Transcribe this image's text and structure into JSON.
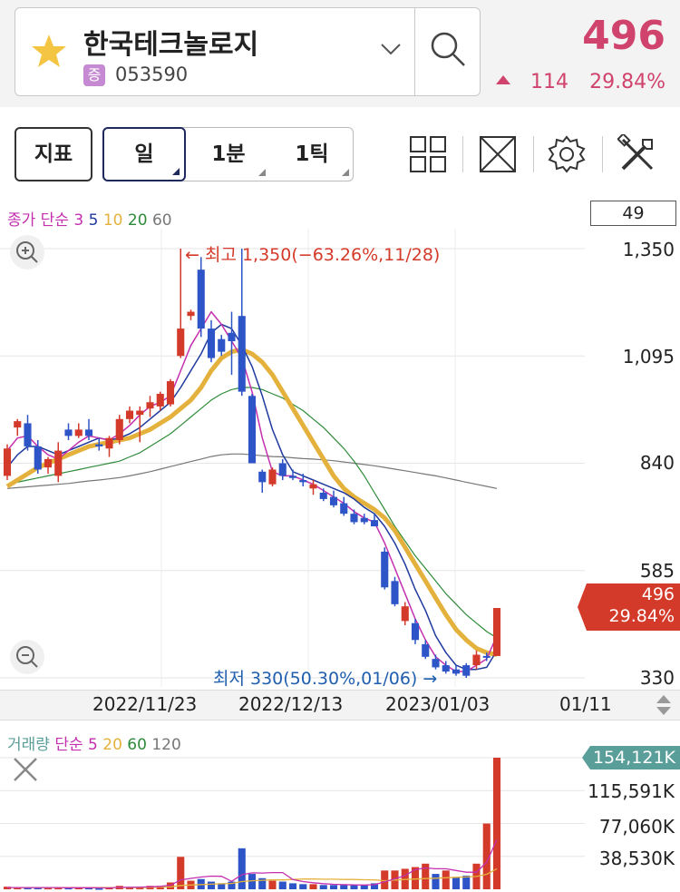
{
  "stock": {
    "name": "한국테크놀로지",
    "market_badge": "증",
    "code": "053590",
    "price": "496",
    "change_abs": "114",
    "change_pct": "29.84%",
    "direction": "up",
    "color_up": "#d0436c"
  },
  "toolbar": {
    "indicator_label": "지표",
    "period_tabs": [
      {
        "label": "일",
        "active": true
      },
      {
        "label": "1분",
        "active": false
      },
      {
        "label": "1틱",
        "active": false
      }
    ],
    "icons": [
      "layout-grid-icon",
      "fullscreen-icon",
      "settings-icon",
      "tools-icon"
    ]
  },
  "price_chart": {
    "legend_prefix": "종가 단순",
    "ma_periods": [
      "3",
      "5",
      "10",
      "20",
      "60"
    ],
    "ma_colors": [
      "#c42fae",
      "#1f3a9e",
      "#e4b23c",
      "#2e8b3a",
      "#777777"
    ],
    "visible_count": "49",
    "y_ticks": [
      "1,350",
      "1,095",
      "840",
      "585",
      "330"
    ],
    "current_tag": [
      "496",
      "29.84%"
    ],
    "high_annotation": "최고 1,350(−63.26%,11/28)",
    "low_annotation": "최저 330(50.30%,01/06)",
    "x_ticks": [
      "2022/11/23",
      "2022/12/13",
      "2023/01/03",
      "01/11"
    ]
  },
  "volume_chart": {
    "legend_prefix": "거래량 단순",
    "ma_periods": [
      "5",
      "20",
      "60",
      "120"
    ],
    "current_tag": "154,121K",
    "y_ticks": [
      "115,591K",
      "77,060K",
      "38,530K"
    ]
  },
  "chart_data": {
    "type": "candlestick",
    "ylim": [
      300,
      1400
    ],
    "candles": [
      {
        "o": 810,
        "h": 885,
        "l": 800,
        "c": 875,
        "up": true
      },
      {
        "o": 925,
        "h": 945,
        "l": 905,
        "c": 940,
        "up": true
      },
      {
        "o": 935,
        "h": 955,
        "l": 870,
        "c": 880,
        "up": false
      },
      {
        "o": 880,
        "h": 895,
        "l": 815,
        "c": 825,
        "up": false
      },
      {
        "o": 830,
        "h": 855,
        "l": 815,
        "c": 850,
        "up": true
      },
      {
        "o": 810,
        "h": 890,
        "l": 795,
        "c": 870,
        "up": true
      },
      {
        "o": 920,
        "h": 935,
        "l": 895,
        "c": 905,
        "up": false
      },
      {
        "o": 905,
        "h": 935,
        "l": 900,
        "c": 920,
        "up": true
      },
      {
        "o": 920,
        "h": 945,
        "l": 895,
        "c": 905,
        "up": false
      },
      {
        "o": 885,
        "h": 900,
        "l": 870,
        "c": 880,
        "up": false
      },
      {
        "o": 875,
        "h": 905,
        "l": 855,
        "c": 900,
        "up": true
      },
      {
        "o": 895,
        "h": 955,
        "l": 885,
        "c": 945,
        "up": true
      },
      {
        "o": 945,
        "h": 975,
        "l": 935,
        "c": 965,
        "up": true
      },
      {
        "o": 955,
        "h": 975,
        "l": 890,
        "c": 965,
        "up": true
      },
      {
        "o": 970,
        "h": 1000,
        "l": 950,
        "c": 985,
        "up": true
      },
      {
        "o": 975,
        "h": 1010,
        "l": 965,
        "c": 1005,
        "up": true
      },
      {
        "o": 980,
        "h": 1040,
        "l": 975,
        "c": 1035,
        "up": true
      },
      {
        "o": 1095,
        "h": 1350,
        "l": 1090,
        "c": 1160,
        "up": true
      },
      {
        "o": 1200,
        "h": 1205,
        "l": 1180,
        "c": 1190,
        "up": true
      },
      {
        "o": 1300,
        "h": 1330,
        "l": 1140,
        "c": 1160,
        "up": false
      },
      {
        "o": 1160,
        "h": 1180,
        "l": 1080,
        "c": 1090,
        "up": false
      },
      {
        "o": 1135,
        "h": 1145,
        "l": 1095,
        "c": 1105,
        "up": false
      },
      {
        "o": 1150,
        "h": 1200,
        "l": 1050,
        "c": 1130,
        "up": false
      },
      {
        "o": 1190,
        "h": 1350,
        "l": 1000,
        "c": 1010,
        "up": false
      },
      {
        "o": 1000,
        "h": 1005,
        "l": 840,
        "c": 840,
        "up": false
      },
      {
        "o": 820,
        "h": 825,
        "l": 770,
        "c": 795,
        "up": false
      },
      {
        "o": 790,
        "h": 830,
        "l": 785,
        "c": 825,
        "up": true
      },
      {
        "o": 840,
        "h": 850,
        "l": 800,
        "c": 810,
        "up": false
      },
      {
        "o": 810,
        "h": 825,
        "l": 800,
        "c": 805,
        "up": false
      },
      {
        "o": 800,
        "h": 815,
        "l": 785,
        "c": 795,
        "up": false
      },
      {
        "o": 780,
        "h": 800,
        "l": 765,
        "c": 790,
        "up": true
      },
      {
        "o": 770,
        "h": 780,
        "l": 750,
        "c": 755,
        "up": false
      },
      {
        "o": 760,
        "h": 775,
        "l": 735,
        "c": 740,
        "up": false
      },
      {
        "o": 745,
        "h": 760,
        "l": 715,
        "c": 720,
        "up": false
      },
      {
        "o": 720,
        "h": 730,
        "l": 695,
        "c": 700,
        "up": false
      },
      {
        "o": 710,
        "h": 720,
        "l": 695,
        "c": 700,
        "up": false
      },
      {
        "o": 705,
        "h": 720,
        "l": 690,
        "c": 690,
        "up": false
      },
      {
        "o": 630,
        "h": 640,
        "l": 540,
        "c": 545,
        "up": false
      },
      {
        "o": 560,
        "h": 570,
        "l": 500,
        "c": 505,
        "up": false
      },
      {
        "o": 500,
        "h": 510,
        "l": 455,
        "c": 465,
        "up": true
      },
      {
        "o": 460,
        "h": 470,
        "l": 410,
        "c": 420,
        "up": false
      },
      {
        "o": 410,
        "h": 420,
        "l": 375,
        "c": 380,
        "up": false
      },
      {
        "o": 375,
        "h": 385,
        "l": 350,
        "c": 355,
        "up": false
      },
      {
        "o": 360,
        "h": 370,
        "l": 340,
        "c": 345,
        "up": false
      },
      {
        "o": 350,
        "h": 360,
        "l": 335,
        "c": 340,
        "up": false
      },
      {
        "o": 335,
        "h": 365,
        "l": 330,
        "c": 360,
        "up": false
      },
      {
        "o": 360,
        "h": 395,
        "l": 350,
        "c": 385,
        "up": true
      },
      {
        "o": 380,
        "h": 390,
        "l": 370,
        "c": 382,
        "up": false
      },
      {
        "o": 382,
        "h": 496,
        "l": 382,
        "c": 496,
        "up": true
      }
    ],
    "ma3": [
      870,
      900,
      905,
      880,
      860,
      850,
      870,
      890,
      905,
      900,
      895,
      910,
      930,
      955,
      975,
      985,
      1000,
      1060,
      1120,
      1160,
      1200,
      1170,
      1130,
      1090,
      1010,
      900,
      820,
      810,
      810,
      800,
      790,
      775,
      760,
      745,
      725,
      710,
      700,
      650,
      590,
      530,
      470,
      420,
      380,
      360,
      345,
      345,
      360,
      375,
      430
    ],
    "ma5": [
      830,
      860,
      880,
      880,
      870,
      860,
      870,
      880,
      890,
      900,
      895,
      900,
      910,
      925,
      945,
      965,
      985,
      1020,
      1060,
      1100,
      1150,
      1170,
      1160,
      1120,
      1070,
      1000,
      920,
      860,
      820,
      810,
      800,
      790,
      780,
      770,
      755,
      735,
      720,
      690,
      650,
      600,
      540,
      490,
      430,
      390,
      360,
      350,
      350,
      355,
      395
    ],
    "ma10": [
      785,
      800,
      815,
      830,
      840,
      850,
      860,
      870,
      880,
      885,
      890,
      895,
      900,
      910,
      920,
      935,
      950,
      970,
      990,
      1020,
      1060,
      1090,
      1105,
      1110,
      1100,
      1080,
      1050,
      1010,
      970,
      930,
      890,
      850,
      810,
      780,
      760,
      745,
      730,
      710,
      680,
      640,
      600,
      560,
      520,
      480,
      445,
      420,
      400,
      390,
      385
    ],
    "ma20": [
      790,
      795,
      800,
      805,
      810,
      815,
      820,
      825,
      830,
      835,
      840,
      845,
      855,
      865,
      880,
      895,
      910,
      930,
      950,
      970,
      990,
      1005,
      1015,
      1020,
      1020,
      1015,
      1005,
      995,
      980,
      965,
      945,
      925,
      900,
      875,
      845,
      810,
      770,
      730,
      690,
      655,
      620,
      590,
      560,
      530,
      505,
      480,
      460,
      440,
      425
    ],
    "ma60": [
      780,
      782,
      784,
      786,
      788,
      790,
      792,
      795,
      798,
      800,
      803,
      806,
      810,
      815,
      820,
      826,
      832,
      838,
      844,
      850,
      856,
      860,
      862,
      862,
      860,
      858,
      856,
      855,
      853,
      851,
      850,
      848,
      846,
      843,
      840,
      837,
      834,
      830,
      826,
      822,
      818,
      814,
      810,
      805,
      800,
      795,
      790,
      785,
      780
    ],
    "volume_max": 154121,
    "volume": [
      {
        "v": 3000,
        "up": true
      },
      {
        "v": 2000,
        "up": true
      },
      {
        "v": 2000,
        "up": false
      },
      {
        "v": 2000,
        "up": false
      },
      {
        "v": 1500,
        "up": true
      },
      {
        "v": 1500,
        "up": true
      },
      {
        "v": 1500,
        "up": false
      },
      {
        "v": 2500,
        "up": true
      },
      {
        "v": 1500,
        "up": false
      },
      {
        "v": 1000,
        "up": false
      },
      {
        "v": 1500,
        "up": true
      },
      {
        "v": 4000,
        "up": true
      },
      {
        "v": 2500,
        "up": true
      },
      {
        "v": 2500,
        "up": true
      },
      {
        "v": 4000,
        "up": true
      },
      {
        "v": 4000,
        "up": true
      },
      {
        "v": 8000,
        "up": true
      },
      {
        "v": 38000,
        "up": true
      },
      {
        "v": 10000,
        "up": true
      },
      {
        "v": 12000,
        "up": false
      },
      {
        "v": 9000,
        "up": false
      },
      {
        "v": 7000,
        "up": false
      },
      {
        "v": 9000,
        "up": false
      },
      {
        "v": 48000,
        "up": false
      },
      {
        "v": 18000,
        "up": false
      },
      {
        "v": 13000,
        "up": false
      },
      {
        "v": 10000,
        "up": true
      },
      {
        "v": 9000,
        "up": false
      },
      {
        "v": 7000,
        "up": false
      },
      {
        "v": 6000,
        "up": false
      },
      {
        "v": 6000,
        "up": true
      },
      {
        "v": 5000,
        "up": false
      },
      {
        "v": 5000,
        "up": false
      },
      {
        "v": 5000,
        "up": false
      },
      {
        "v": 5000,
        "up": false
      },
      {
        "v": 5000,
        "up": false
      },
      {
        "v": 7000,
        "up": false
      },
      {
        "v": 22000,
        "up": true
      },
      {
        "v": 22000,
        "up": true
      },
      {
        "v": 24000,
        "up": true
      },
      {
        "v": 26000,
        "up": true
      },
      {
        "v": 30000,
        "up": true
      },
      {
        "v": 18000,
        "up": false
      },
      {
        "v": 22000,
        "up": true
      },
      {
        "v": 14000,
        "up": false
      },
      {
        "v": 16000,
        "up": false
      },
      {
        "v": 30000,
        "up": true
      },
      {
        "v": 77000,
        "up": true
      },
      {
        "v": 154121,
        "up": true
      }
    ],
    "vol_ma5": [
      2000,
      2000,
      2000,
      2000,
      2000,
      2000,
      1800,
      1800,
      1800,
      1700,
      1600,
      2200,
      2300,
      2500,
      2900,
      3400,
      4800,
      11000,
      12800,
      14400,
      15400,
      15200,
      9400,
      17000,
      19200,
      19000,
      19600,
      19600,
      11400,
      9000,
      7600,
      6600,
      5800,
      5400,
      5200,
      5000,
      5400,
      8800,
      12200,
      16000,
      23200,
      25000,
      24000,
      24000,
      22000,
      20000,
      20000,
      31800,
      58000
    ],
    "vol_ma20": [
      2000,
      2000,
      2000,
      2000,
      2000,
      2000,
      2000,
      2000,
      2000,
      2000,
      2000,
      2000,
      2000,
      2000,
      2300,
      2500,
      2800,
      4500,
      5000,
      5500,
      6000,
      6500,
      6800,
      9000,
      10000,
      10500,
      11000,
      11000,
      11500,
      12000,
      12000,
      11800,
      11800,
      11500,
      11500,
      11200,
      11000,
      10000,
      10800,
      11500,
      12000,
      12500,
      13000,
      13500,
      14000,
      14500,
      15000,
      17500,
      24000
    ],
    "x": [
      "2022/11/23",
      "2022/12/13",
      "2023/01/03",
      "01/11"
    ]
  }
}
